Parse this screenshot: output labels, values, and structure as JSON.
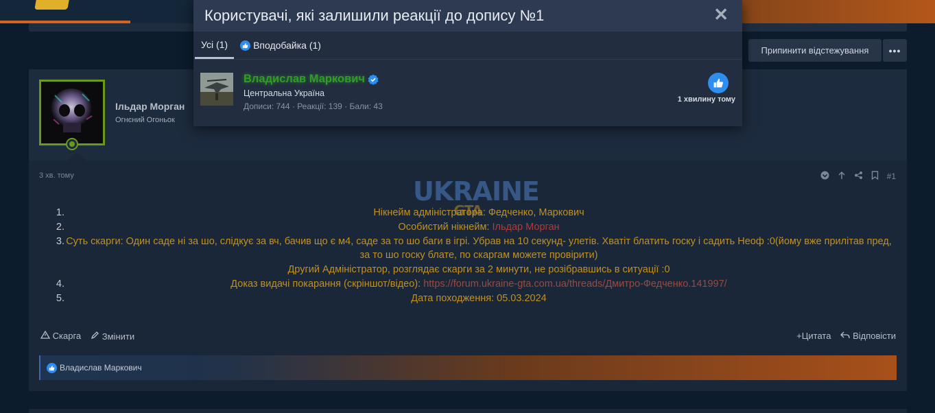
{
  "modal": {
    "title": "Користувачі, які залишили реакції до допису №1",
    "close_icon": "close-icon",
    "tabs": [
      {
        "label": "Усі (1)"
      },
      {
        "label": "Вподобайка (1)"
      }
    ],
    "member": {
      "name": "Владислав Маркович",
      "title": "Центральна Україна",
      "stats": "Дописи: 744 · Реакції: 139 · Бали: 43",
      "time": "1 хвилину тому"
    }
  },
  "toolbar": {
    "unwatch_label": "Припинити відстежування",
    "more_label": "•••"
  },
  "post": {
    "author": "Ільдар Морган",
    "author_title": "Огнєний Огоньок",
    "time": "3 хв. тому",
    "number": "#1",
    "watermark_top": "UKRAINE",
    "watermark_bottom": "GTA",
    "lines": [
      {
        "num": "1.",
        "text": "Нікнейм адміністратора: Федченко, Маркович"
      },
      {
        "num": "2.",
        "prefix": "Особистий нікнейм: ",
        "highlight": "Ільдар Морган"
      },
      {
        "num": "3.",
        "text": "Суть скарги: Один саде ні за шо, слідкує за вч, бачив що є м4, саде за то шо баги в ігрі. Убрав на 10 секунд- улетів. Хватіт блатить госку і садить Неоф :0(йому вже прилітав пред, за то шо госку блате, по скаргам можете провірити)"
      },
      {
        "num": "",
        "text": "Другий Адміністратор, розглядає скарги за 2 минути, не розібравшись в ситуації :0"
      },
      {
        "num": "4.",
        "prefix": "Доказ видачі покарання (скріншот/відео): ",
        "link": "https://forum.ukraine-gta.com.ua/threads/Дмитро-Федченко.141997/"
      },
      {
        "num": "5.",
        "text": "Дата походження: 05.03.2024"
      }
    ],
    "actions_left": [
      "Скарга",
      "Змінити"
    ],
    "actions_right": [
      "Цитата",
      "Відповісти"
    ],
    "reaction_user": "Владислав Маркович"
  },
  "colors": {
    "accent_green": "#2f9e24",
    "like_blue": "#2d8ef0",
    "content_gold": "#c2901e"
  }
}
